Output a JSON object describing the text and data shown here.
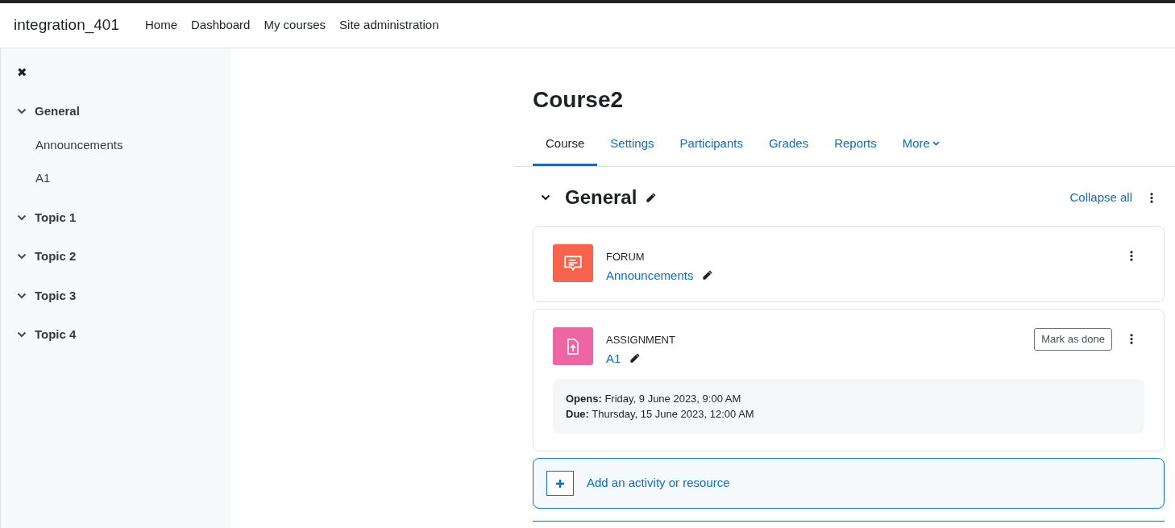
{
  "site_name": "integration_401",
  "nav": [
    "Home",
    "Dashboard",
    "My courses",
    "Site administration"
  ],
  "drawer": {
    "close_glyph": "✖",
    "sections": [
      {
        "title": "General",
        "children": [
          "Announcements",
          "A1"
        ]
      },
      {
        "title": "Topic 1"
      },
      {
        "title": "Topic 2"
      },
      {
        "title": "Topic 3"
      },
      {
        "title": "Topic 4"
      }
    ]
  },
  "course_title": "Course2",
  "tabs": [
    {
      "label": "Course",
      "selected": true,
      "dropdown": false
    },
    {
      "label": "Settings",
      "selected": false,
      "dropdown": false
    },
    {
      "label": "Participants",
      "selected": false,
      "dropdown": false
    },
    {
      "label": "Grades",
      "selected": false,
      "dropdown": false
    },
    {
      "label": "Reports",
      "selected": false,
      "dropdown": false
    },
    {
      "label": "More",
      "selected": false,
      "dropdown": true
    }
  ],
  "section": {
    "title": "General",
    "collapse_link": "Collapse all"
  },
  "activities": [
    {
      "kind": "forum",
      "type_label": "FORUM",
      "name": "Announcements"
    },
    {
      "kind": "assignment",
      "type_label": "ASSIGNMENT",
      "name": "A1",
      "completion_button": "Mark as done",
      "dates": [
        "**Opens:** Friday, 9 June 2023, 9:00 AM",
        "**Due:** Thursday, 15 June 2023, 12:00 AM"
      ]
    }
  ],
  "add_activity": "Add an activity or resource"
}
